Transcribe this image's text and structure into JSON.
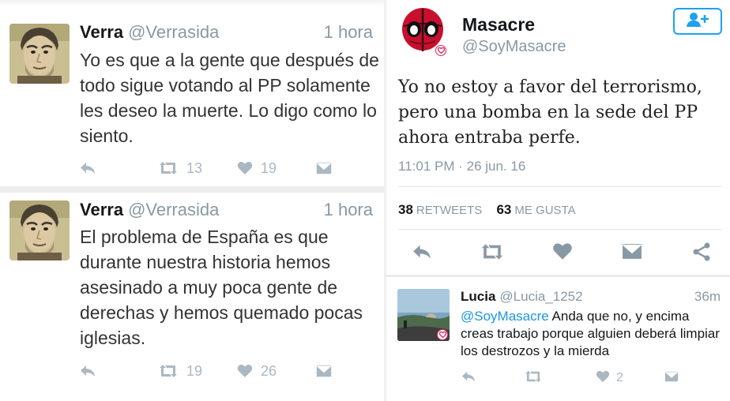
{
  "left_column": {
    "tweets": [
      {
        "name": "Verra",
        "handle": "@Verrasida",
        "time": "1 hora",
        "text": "Yo es que a la gente que después de todo sigue votando al PP solamente les deseo la muerte. Lo digo como lo siento.",
        "retweets": "13",
        "likes": "19",
        "icons": [
          "reply-icon",
          "retweet-icon",
          "heart-icon",
          "message-icon"
        ]
      },
      {
        "name": "Verra",
        "handle": "@Verrasida",
        "time": "1 hora",
        "text": "El problema de España es que durante nuestra historia hemos asesinado a muy poca gente de derechas y hemos quemado pocas iglesias.",
        "retweets": "19",
        "likes": "26",
        "icons": [
          "reply-icon",
          "retweet-icon",
          "heart-icon",
          "message-icon"
        ]
      }
    ]
  },
  "right_column": {
    "main_tweet": {
      "name": "Masacre",
      "handle": "@SoyMasacre",
      "text": "Yo no estoy a favor del terrorismo, pero una bomba en la sede del PP ahora entraba perfe.",
      "date": "11:01 PM · 26 jun. 16",
      "retweet_count": "38",
      "retweet_label": "RETWEETS",
      "like_count": "63",
      "like_label": "ME GUSTA",
      "icons": [
        "reply-icon",
        "retweet-icon",
        "heart-icon",
        "message-icon",
        "share-icon",
        "follow-user-icon"
      ]
    },
    "reply": {
      "name": "Lucia",
      "handle": "@Lucia_1252",
      "time": "36m",
      "mention": "@SoyMasacre",
      "text": " Anda que no, y encima creas trabajo porque alguien deberá limpiar los destrozos y la mierda",
      "likes": "2",
      "icons": [
        "reply-icon",
        "retweet-icon",
        "heart-icon",
        "message-icon"
      ]
    }
  },
  "colors": {
    "accent": "#1da1f2",
    "mention": "#1b95e0",
    "muted": "#8899a6",
    "icon_gray": "#aab8c2",
    "icon_dark": "#8899a6"
  }
}
